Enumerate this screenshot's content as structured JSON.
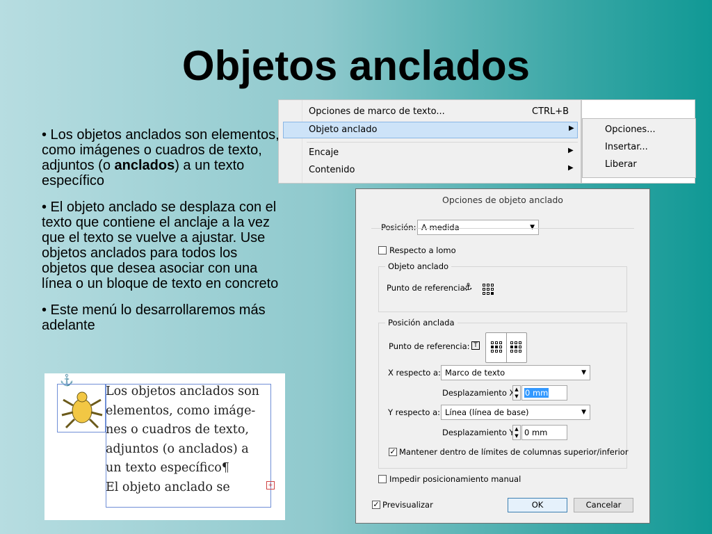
{
  "slide": {
    "title": "Objetos anclados",
    "bullets": {
      "b1_pre": "• Los objetos anclados son elementos, como imágenes o cuadros de texto, adjuntos (o ",
      "b1_bold": "anclados",
      "b1_post": ") a un texto específico",
      "b2": "• El objeto anclado se desplaza con el texto que contiene el anclaje a la vez que el texto se vuelve a ajustar. Use objetos anclados para todos los objetos que desea asociar con una línea o un bloque de texto en concreto",
      "b3": "• Este menú lo desarrollaremos más adelante"
    }
  },
  "context_menu": {
    "items": [
      {
        "label": "Opciones de marco de texto...",
        "shortcut": "CTRL+B"
      },
      {
        "label": "Objeto anclado",
        "arrow": "▶"
      },
      {
        "label": "Encaje",
        "arrow": "▶"
      },
      {
        "label": "Contenido",
        "arrow": "▶"
      }
    ],
    "submenu": [
      "Opciones...",
      "Insertar...",
      "Liberar"
    ]
  },
  "dialog": {
    "title": "Opciones de objeto anclado",
    "posicion_label": "Posición:",
    "posicion_value": "A medida",
    "respecto_lomo": "Respecto a lomo",
    "grupo_objeto": "Objeto anclado",
    "punto_ref_label": "Punto de referencia:",
    "grupo_posicion": "Posición anclada",
    "punto_ref_label2": "Punto de referencia:",
    "x_label": "X respecto a:",
    "x_value": "Marco de texto",
    "despl_x_label": "Desplazamiento X:",
    "despl_x_value": "0 mm",
    "y_label": "Y respecto a:",
    "y_value": "Línea (línea de base)",
    "despl_y_label": "Desplazamiento Y:",
    "despl_y_value": "0 mm",
    "mantener_label": "Mantener dentro de límites de columnas superior/inferior",
    "impedir_label": "Impedir posicionamiento manual",
    "previsualizar_label": "Previsualizar",
    "ok_label": "OK",
    "cancel_label": "Cancelar",
    "checked_mark": "✓"
  },
  "example": {
    "lines": [
      "Los objetos anclados son",
      "elementos, como imáge-",
      "nes o cuadros de texto,",
      "adjuntos (o anclados) a",
      "un texto específico¶",
      "El objeto anclado se"
    ],
    "anchor_glyph": "⚓",
    "overflow_glyph": "+"
  }
}
